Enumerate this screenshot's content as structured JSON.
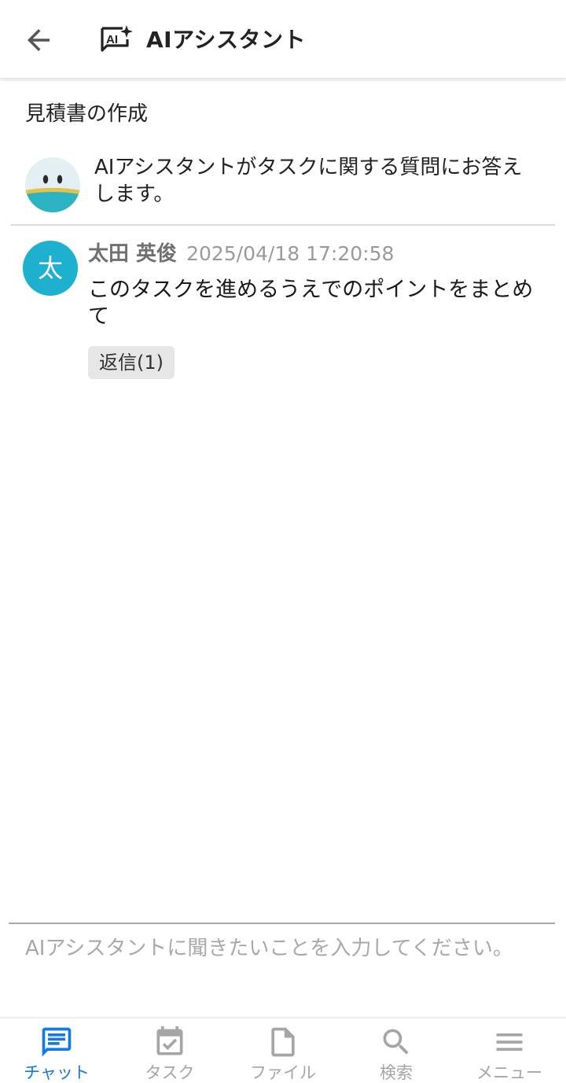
{
  "header": {
    "back_icon": "arrow-left-icon",
    "ai_icon": "ai-sparkle-chat-icon",
    "title": "AIアシスタント"
  },
  "task": {
    "title": "見積書の作成"
  },
  "bot": {
    "avatar_icon": "ai-bot-face-avatar",
    "text": "AIアシスタントがタスクに関する質問にお答えします。"
  },
  "messages": [
    {
      "avatar_initial": "太",
      "avatar_color": "#1eb0cf",
      "user": "太田 英俊",
      "timestamp": "2025/04/18 17:20:58",
      "body": "このタスクを進めるうえでのポイントをまとめて",
      "reply_label": "返信(1)"
    }
  ],
  "composer": {
    "placeholder": "AIアシスタントに聞きたいことを入力してください。"
  },
  "tabs": [
    {
      "label": "チャット",
      "icon": "chat-icon",
      "active": true
    },
    {
      "label": "タスク",
      "icon": "task-calendar-icon",
      "active": false
    },
    {
      "label": "ファイル",
      "icon": "file-icon",
      "active": false
    },
    {
      "label": "検索",
      "icon": "search-icon",
      "active": false
    },
    {
      "label": "メニュー",
      "icon": "menu-icon",
      "active": false
    }
  ],
  "colors": {
    "accent": "#1479e8",
    "inactive": "#a5a5a5",
    "avatar": "#1eb0cf"
  }
}
